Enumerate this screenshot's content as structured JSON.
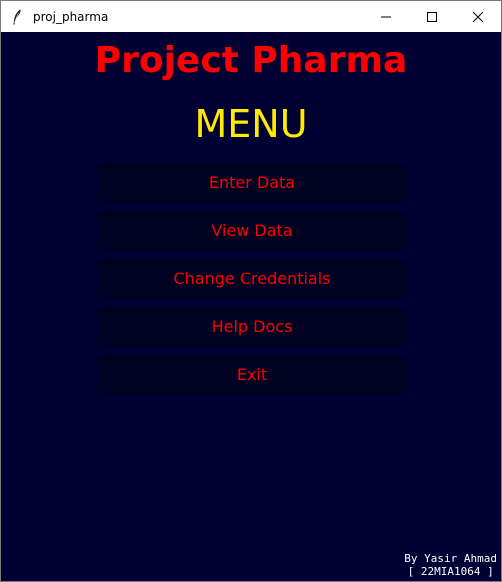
{
  "window": {
    "title": "proj_pharma",
    "icon": "feather-icon",
    "controls": [
      "minimize-icon",
      "maximize-icon",
      "close-icon"
    ]
  },
  "app": {
    "title": "Project Pharma",
    "menu_heading": "MENU"
  },
  "menu": {
    "items": [
      {
        "label": "Enter Data"
      },
      {
        "label": "View Data"
      },
      {
        "label": "Change Credentials"
      },
      {
        "label": "Help Docs"
      },
      {
        "label": "Exit"
      }
    ]
  },
  "credits": {
    "author": "By Yasir Ahmad",
    "id": "[ 22MIA1064 ]"
  },
  "colors": {
    "background": "#000033",
    "button_background": "#000021",
    "title": "#ff0000",
    "menu_heading": "#ffea00",
    "button_text": "#ff0000",
    "credits_text": "#ffffff"
  }
}
